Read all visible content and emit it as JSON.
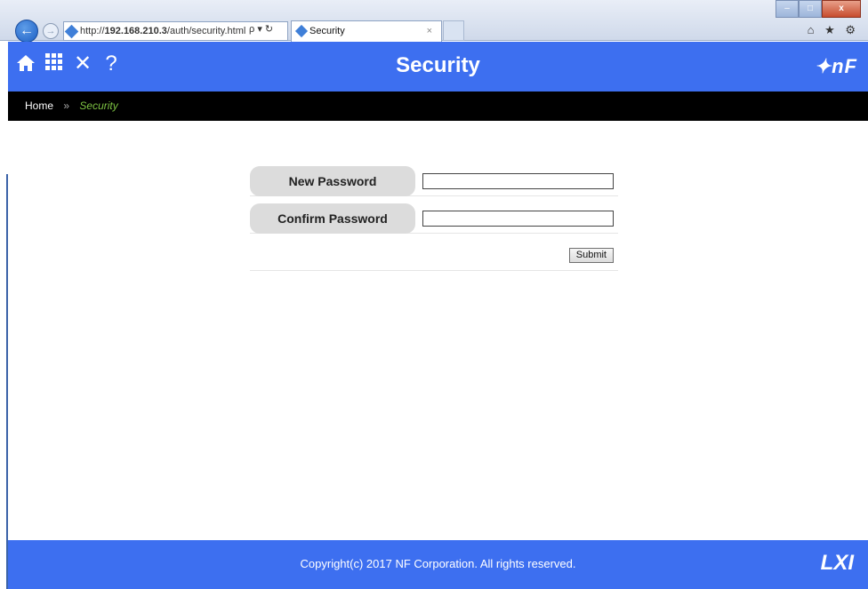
{
  "browser": {
    "address_url_prefix": "http://",
    "address_url_host": "192.168.210.3",
    "address_url_path": "/auth/security.html",
    "address_tools": "ρ ▾ ↻",
    "tab_title": "Security",
    "tab_close": "×",
    "back_glyph": "←",
    "forward_glyph": "→",
    "right_tools": "⌂ ★ ⚙",
    "window_buttons": {
      "minimize": "–",
      "maximize": "□",
      "close": "x"
    }
  },
  "header": {
    "title": "Security",
    "brand": "✦nF",
    "icons": [
      "home-icon",
      "grid-icon",
      "tools-icon",
      "help-icon"
    ],
    "help_glyph": "?",
    "tools_glyph": "✕"
  },
  "breadcrumb": {
    "home": "Home",
    "separator": "»",
    "current": "Security"
  },
  "form": {
    "new_password_label": "New Password",
    "new_password_value": "",
    "confirm_password_label": "Confirm Password",
    "confirm_password_value": "",
    "submit_label": "Submit"
  },
  "footer": {
    "copyright": "Copyright(c) 2017 NF Corporation. All rights reserved.",
    "lxi_logo": "LXI"
  },
  "colors": {
    "brand_blue": "#3d6ff0",
    "breadcrumb_bg": "#000000",
    "breadcrumb_current": "#7cc142",
    "label_bg": "#dcdcdc"
  }
}
